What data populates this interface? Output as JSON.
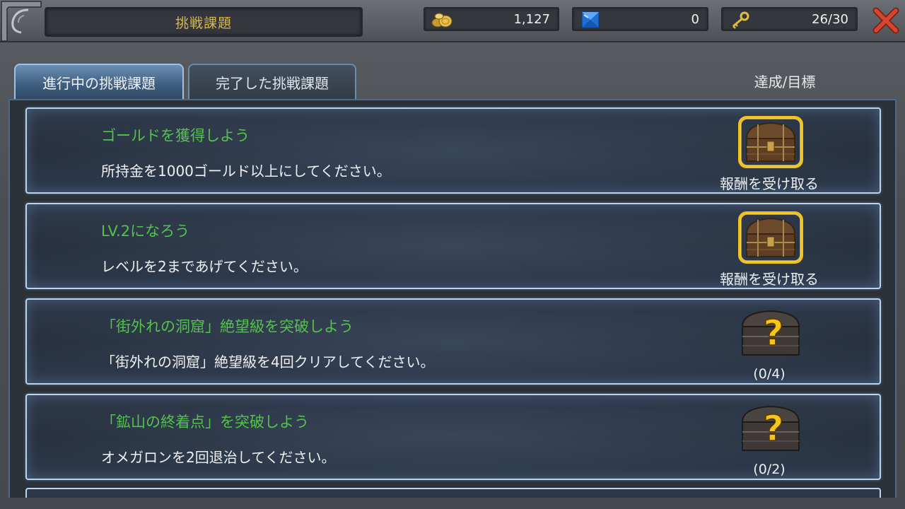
{
  "header": {
    "title": "挑戦課題",
    "gold": "1,127",
    "gems": "0",
    "keys": "26/30"
  },
  "tabs": [
    {
      "label": "進行中の挑戦課題",
      "active": true
    },
    {
      "label": "完了した挑戦課題",
      "active": false
    }
  ],
  "column_header": "達成/目標",
  "challenges": [
    {
      "title": "ゴールドを獲得しよう",
      "description": "所持金を1000ゴールド以上にしてください。",
      "reward_label": "報酬を受け取る",
      "state": "claimable"
    },
    {
      "title": "LV.2になろう",
      "description": "レベルを2まであげてください。",
      "reward_label": "報酬を受け取る",
      "state": "claimable"
    },
    {
      "title": "「街外れの洞窟」絶望級を突破しよう",
      "description": "「街外れの洞窟」絶望級を4回クリアしてください。",
      "reward_label": "(0/4)",
      "state": "locked"
    },
    {
      "title": "「鉱山の終着点」を突破しよう",
      "description": "オメガロンを2回退治してください。",
      "reward_label": "(0/2)",
      "state": "locked"
    }
  ],
  "colors": {
    "title_gold": "#d9b54c",
    "challenge_title_green": "#52c44a",
    "card_border": "#b9d4f1",
    "close_red": "#d8452e"
  },
  "icons": {
    "gold": "gold-coins-icon",
    "gem": "blue-gem-icon",
    "key": "key-icon",
    "close": "close-icon",
    "reward_open": "treasure-chest-icon",
    "reward_locked": "mystery-chest-icon"
  }
}
